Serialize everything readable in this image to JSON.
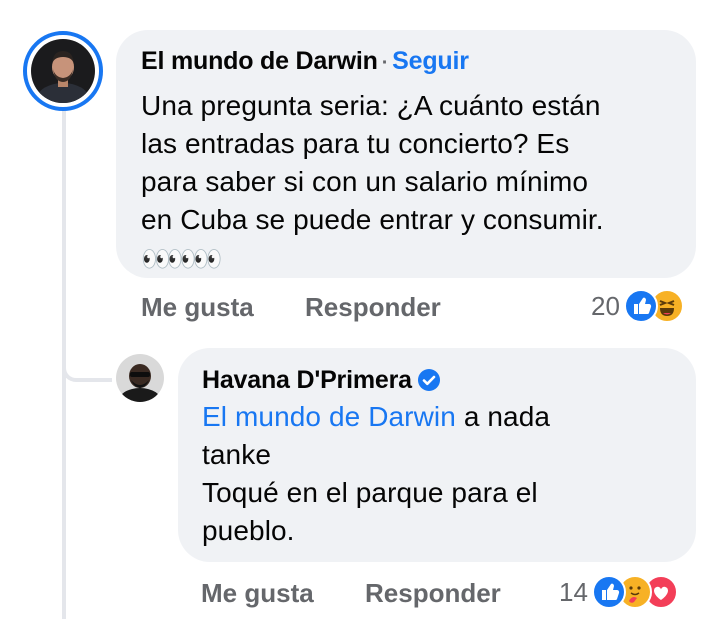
{
  "comment": {
    "author": "El mundo de Darwin",
    "separator": "·",
    "follow_label": "Seguir",
    "text": "Una pregunta seria: ¿A cuánto están\nlas entradas para tu concierto?  Es\npara saber si con un salario mínimo\nen Cuba se puede entrar y consumir.",
    "emoji": "👀👀👀",
    "like_label": "Me gusta",
    "reply_label": "Responder",
    "reaction_count": "20",
    "reactions": [
      "like-icon",
      "haha-icon"
    ]
  },
  "reply": {
    "author": "Havana D'Primera",
    "verified": true,
    "mention": "El mundo de Darwin",
    "text_after_mention": " a nada\ntanke\nToqué en el parque para el\npueblo.",
    "like_label": "Me gusta",
    "reply_label": "Responder",
    "reaction_count": "14",
    "reactions": [
      "like-icon",
      "care-icon",
      "love-icon"
    ]
  },
  "colors": {
    "accent": "#1877f2",
    "bubble": "#f0f2f5",
    "muted": "#65676b",
    "love": "#f33e58",
    "haha": "#f7b125"
  }
}
